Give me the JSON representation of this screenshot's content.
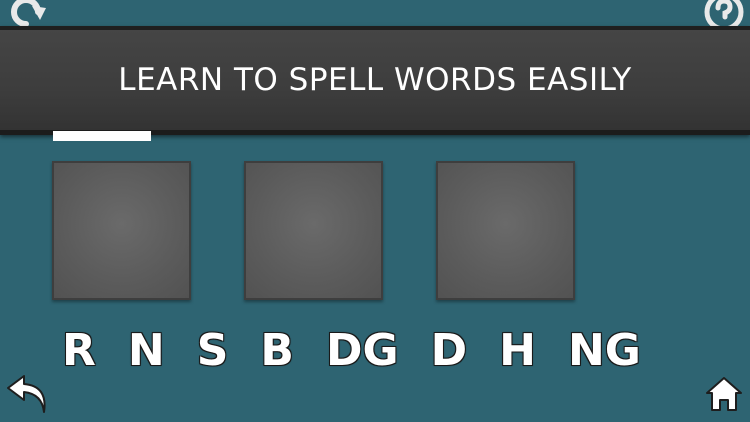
{
  "header": {
    "title": "LEARN TO SPELL WORDS EASILY"
  },
  "progress": {
    "fraction": 0.13
  },
  "slots": [
    {
      "letter": ""
    },
    {
      "letter": ""
    },
    {
      "letter": ""
    }
  ],
  "letters": [
    {
      "label": "R"
    },
    {
      "label": "N"
    },
    {
      "label": "S"
    },
    {
      "label": "B"
    },
    {
      "label": "DG"
    },
    {
      "label": "D"
    },
    {
      "label": "H"
    },
    {
      "label": "NG"
    }
  ],
  "icons": {
    "top_left": "refresh-icon",
    "top_right": "help-icon",
    "bottom_left": "back-arrow-icon",
    "bottom_right": "home-icon"
  },
  "colors": {
    "background": "#2e6472",
    "banner": "#3d3d3d",
    "slot": "#5b5b5b",
    "text": "#ffffff"
  }
}
